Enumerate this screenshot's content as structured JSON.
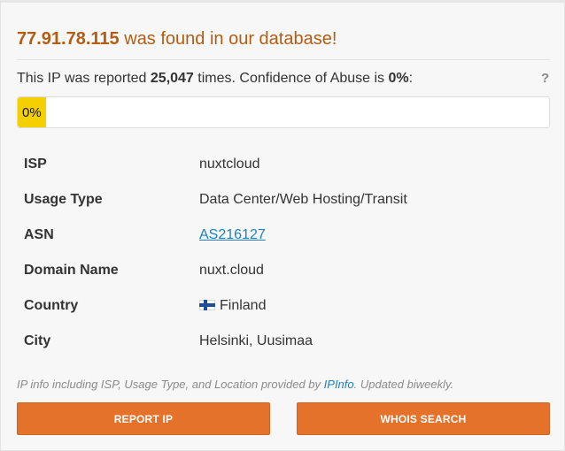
{
  "header": {
    "ip": "77.91.78.115",
    "found_text": " was found in our database!"
  },
  "report": {
    "prefix": "This IP was reported ",
    "count": "25,047",
    "middle": " times. Confidence of Abuse is ",
    "confidence": "0%",
    "suffix": ":",
    "help_label": "?"
  },
  "abuse_bar": {
    "label": "0%",
    "value_percent": 0,
    "fill_color": "#f4d000"
  },
  "details": [
    {
      "key": "ISP",
      "value": "nuxtcloud"
    },
    {
      "key": "Usage Type",
      "value": "Data Center/Web Hosting/Transit"
    },
    {
      "key": "ASN",
      "value": "AS216127"
    },
    {
      "key": "Domain Name",
      "value": "nuxt.cloud"
    },
    {
      "key": "Country",
      "value": "Finland",
      "icon": "finland-flag-icon"
    },
    {
      "key": "City",
      "value": "Helsinki, Uusimaa"
    }
  ],
  "footnote": {
    "before": "IP info including ISP, Usage Type, and Location provided by ",
    "link": "IPInfo",
    "after": ". Updated biweekly."
  },
  "buttons": {
    "report": "REPORT IP",
    "whois": "WHOIS SEARCH"
  },
  "colors": {
    "headline": "#b35c12",
    "button": "#e4722a",
    "link": "#1a7fc4"
  }
}
